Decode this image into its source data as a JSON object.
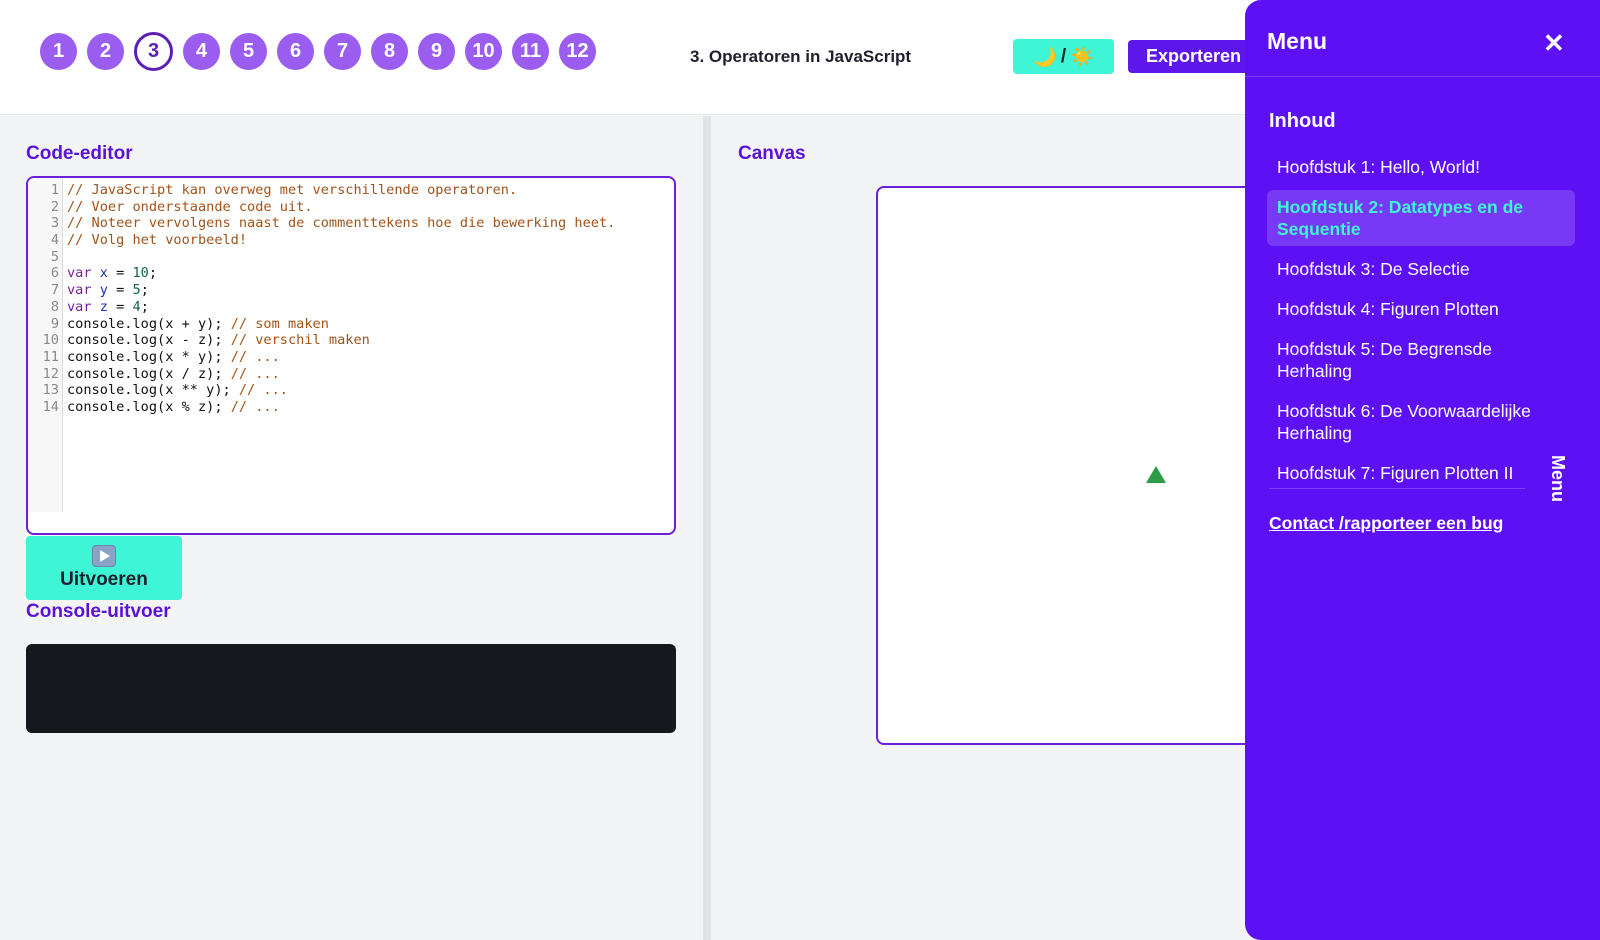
{
  "steps": [
    "1",
    "2",
    "3",
    "4",
    "5",
    "6",
    "7",
    "8",
    "9",
    "10",
    "11",
    "12"
  ],
  "active_step": "3",
  "header": {
    "title": "3. Operatoren in JavaScript",
    "theme_toggle": {
      "moon": "🌙",
      "sep": "/",
      "sun": "☀️"
    },
    "export_label": "Exporteren"
  },
  "editor": {
    "title": "Code-editor",
    "lines": [
      "// JavaScript kan overweg met verschillende operatoren.",
      "// Voer onderstaande code uit.",
      "// Noteer vervolgens naast de commenttekens hoe die bewerking heet.",
      "// Volg het voorbeeld!",
      "",
      "var x = 10;",
      "var y = 5;",
      "var z = 4;",
      "console.log(x + y); // som maken",
      "console.log(x - z); // verschil maken",
      "console.log(x * y); // ...",
      "console.log(x / z); // ...",
      "console.log(x ** y); // ...",
      "console.log(x % z); // ..."
    ]
  },
  "run_button": {
    "icon": "play-button-icon",
    "label": "Uitvoeren"
  },
  "console": {
    "title": "Console-uitvoer",
    "output": ""
  },
  "canvas": {
    "title": "Canvas"
  },
  "menu": {
    "title": "Menu",
    "close": "✕",
    "toc_title": "Inhoud",
    "items": [
      "Hoofdstuk 1: Hello, World!",
      "Hoofdstuk 2: Datatypes en de Sequentie",
      "Hoofdstuk 3: De Selectie",
      "Hoofdstuk 4: Figuren Plotten",
      "Hoofdstuk 5: De Begrensde Herhaling",
      "Hoofdstuk 6: De Voorwaardelijke Herhaling",
      "Hoofdstuk 7: Figuren Plotten II"
    ],
    "active_index": 1,
    "contact": "Contact /rapporteer een bug",
    "side_tab": "Menu"
  },
  "colors": {
    "accent": "#5e17eb",
    "teal": "#3ef5d5",
    "step": "#9b5cf0",
    "turtle": "#2e9b48"
  }
}
